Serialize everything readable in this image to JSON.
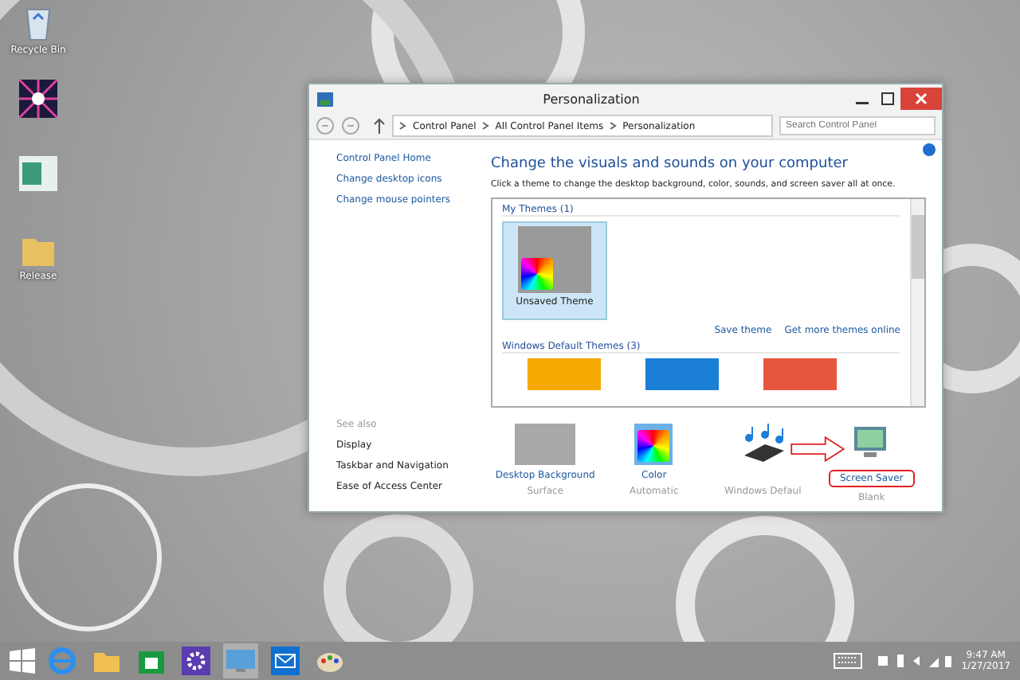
{
  "desktop_icons": [
    {
      "kind": "recycle-bin",
      "label": "Recycle Bin"
    },
    {
      "kind": "app"
    },
    {
      "kind": "shortcut"
    },
    {
      "kind": "folder",
      "label": "Release"
    }
  ],
  "window": {
    "title": "Personalization",
    "breadcrumb": [
      "Control Panel",
      "All Control Panel Items",
      "Personalization"
    ],
    "search": {
      "placeholder": "Search Control Panel"
    },
    "sidebar": {
      "links": [
        "Control Panel Home",
        "Change desktop icons",
        "Change mouse pointers"
      ],
      "see_also_heading": "See also",
      "see_also": [
        "Display",
        "Taskbar and Navigation",
        "Ease of Access Center"
      ]
    },
    "heading": "Change the visuals and sounds on your computer",
    "description": "Click a theme to change the desktop background, color, sounds, and screen saver all at once.",
    "my_themes": {
      "title": "My Themes (1)",
      "themes": [
        {
          "label": "Unsaved Theme",
          "selected": true
        }
      ]
    },
    "theme_links": [
      "Save theme",
      "Get more themes online"
    ],
    "default_themes": {
      "title": "Windows Default Themes (3)",
      "thumbnails": [
        {
          "color": "#f5a800"
        },
        {
          "color": "#1a7fd4"
        },
        {
          "color": "#e8553e"
        }
      ]
    },
    "settings": [
      {
        "kind": "background",
        "label": "Desktop Background",
        "value": "Surface",
        "highlighted": false
      },
      {
        "kind": "color",
        "label": "Color",
        "value": "Automatic",
        "highlighted": false
      },
      {
        "kind": "sounds",
        "value": "Windows Defaul"
      },
      {
        "kind": "screensaver",
        "label": "Screen Saver",
        "value": "Blank",
        "highlighted": true
      }
    ]
  },
  "taskbar": {
    "apps": [
      {
        "kind": "ie",
        "selected": false
      },
      {
        "kind": "explorer",
        "selected": false
      },
      {
        "kind": "store",
        "selected": false
      },
      {
        "kind": "settings",
        "selected": false
      },
      {
        "kind": "control",
        "selected": true
      },
      {
        "kind": "mail",
        "selected": false
      },
      {
        "kind": "paint",
        "selected": false
      }
    ],
    "time": "9:47 AM",
    "date": "1/27/2017"
  }
}
